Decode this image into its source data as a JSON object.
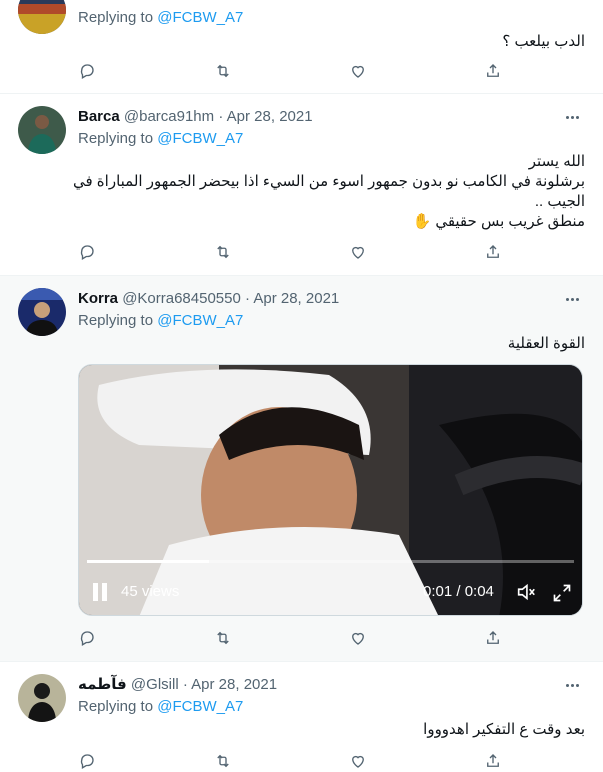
{
  "tweets": [
    {
      "name": "",
      "handle": "",
      "dot": "",
      "date": "",
      "replying_prefix": "Replying to ",
      "replying_to": "@FCBW_A7",
      "text_lines": [
        "الدب بيلعب ؟"
      ]
    },
    {
      "name": "Barca",
      "handle": "@barca91hm",
      "dot": "·",
      "date": "Apr 28, 2021",
      "replying_prefix": "Replying to ",
      "replying_to": "@FCBW_A7",
      "text_lines": [
        "الله يستر",
        "برشلونة في الكامب نو بدون جمهور اسوء من السيء اذا بيحضر الجمهور المباراة في",
        "الجيب ..",
        "منطق غريب بس حقيقي ✋"
      ]
    },
    {
      "name": "Korra",
      "handle": "@Korra68450550",
      "dot": "·",
      "date": "Apr 28, 2021",
      "replying_prefix": "Replying to ",
      "replying_to": "@FCBW_A7",
      "text_lines": [
        "القوة العقلية"
      ],
      "video": {
        "views": "45 views",
        "time": "0:01 / 0:04",
        "progress": 0.25
      }
    },
    {
      "name": "فآطمه",
      "handle": "@Glsill",
      "dot": "·",
      "date": "Apr 28, 2021",
      "replying_prefix": "Replying to ",
      "replying_to": "@FCBW_A7",
      "text_lines": [
        "بعد وقت ع التفكير اهدوووا"
      ]
    }
  ],
  "icons": [
    "reply-icon",
    "retweet-icon",
    "like-icon",
    "share-icon",
    "more-icon",
    "play-icon",
    "volume-mute-icon",
    "fullscreen-icon"
  ],
  "colors": {
    "link": "#1d9bf0",
    "secondary_text": "#536471",
    "primary_text": "#0f1419",
    "hover_background": "#f7f9f9",
    "divider": "#eff3f4"
  }
}
